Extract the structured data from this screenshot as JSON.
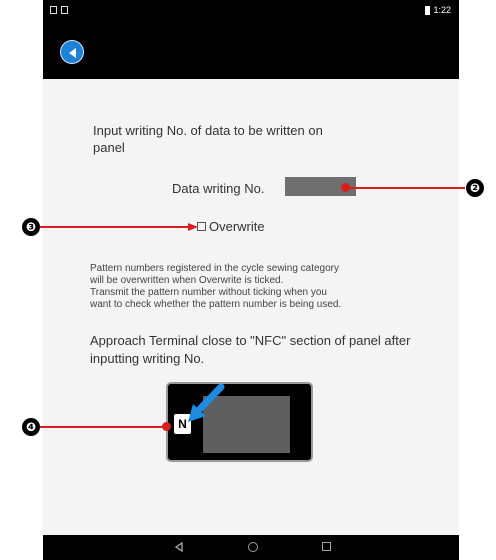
{
  "status_bar": {
    "time": "1:22"
  },
  "header": {
    "back_icon": "back-circle-icon"
  },
  "instruction": "Input writing No. of data to be written on panel",
  "data_writing": {
    "label": "Data writing No.",
    "value": ""
  },
  "overwrite": {
    "label": "Overwrite",
    "checked": false
  },
  "note_lines": [
    "Pattern numbers registered in the cycle sewing category",
    "will be overwritten when Overwrite is ticked.",
    " Transmit the pattern number without ticking when you",
    "want to check whether the pattern number is being used."
  ],
  "approach_text": "Approach Terminal close to \"NFC\" section of panel after inputting writing No.",
  "panel": {
    "nfc_logo_text": "N"
  },
  "callouts": [
    {
      "number": "❷",
      "target": "data-writing-input"
    },
    {
      "number": "❸",
      "target": "overwrite-checkbox"
    },
    {
      "number": "❹",
      "target": "nfc-logo"
    }
  ],
  "colors": {
    "accent": "#1a82d8",
    "callout": "#d81e1e",
    "input": "#6f6f6f"
  },
  "navigation": {
    "back": "back-icon",
    "home": "home-icon",
    "recent": "recent-apps-icon"
  }
}
